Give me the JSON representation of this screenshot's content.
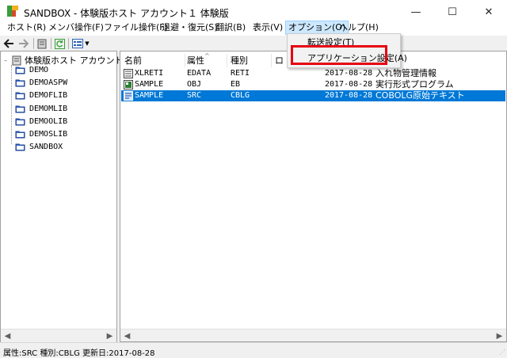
{
  "window": {
    "title": "SANDBOX - 体験版ホスト アカウント１ 体験版",
    "minimize": "—",
    "maximize": "☐",
    "close": "✕"
  },
  "menubar": [
    {
      "label": "ホスト(R)"
    },
    {
      "label": "メンバ操作(F)"
    },
    {
      "label": "ファイル操作(F)"
    },
    {
      "label": "退避・復元(S)"
    },
    {
      "label": "翻訳(B)"
    },
    {
      "label": "表示(V)"
    },
    {
      "label": "オプション(O)",
      "open": true
    },
    {
      "label": "ヘルプ(H)"
    }
  ],
  "options_menu": {
    "items": [
      {
        "label": "転送設定(T)"
      },
      {
        "label": "アプリケーション設定(A)",
        "highlighted": true
      }
    ],
    "highlight_color": "#e60012"
  },
  "tree": {
    "root": "体験版ホスト アカウント１",
    "libraries": [
      "DEMO",
      "DEMOASPW",
      "DEMOFLIB",
      "DEMOMLIB",
      "DEMOOLIB",
      "DEMOSLIB",
      "SANDBOX"
    ]
  },
  "list": {
    "columns": [
      "名前",
      "属性",
      "種別",
      "ロ"
    ],
    "rows": [
      {
        "name": "XLRETI",
        "attr": "EDATA",
        "type": "RETI",
        "date": "2017-08-28",
        "desc": "入れ物管理情報",
        "icon": "data-file-icon",
        "selected": false
      },
      {
        "name": "SAMPLE",
        "attr": "OBJ",
        "type": "EB",
        "date": "2017-08-28",
        "desc": "実行形式プログラム",
        "icon": "executable-icon",
        "selected": false
      },
      {
        "name": "SAMPLE",
        "attr": "SRC",
        "type": "CBLG",
        "date": "2017-08-28",
        "desc": "COBOLG原始テキスト",
        "icon": "source-file-icon",
        "selected": true
      }
    ]
  },
  "status": {
    "text": "属性:SRC 種別:CBLG 更新日:2017-08-28"
  },
  "colors": {
    "selection": "#0078d7",
    "menu_open": "#cce8ff"
  }
}
